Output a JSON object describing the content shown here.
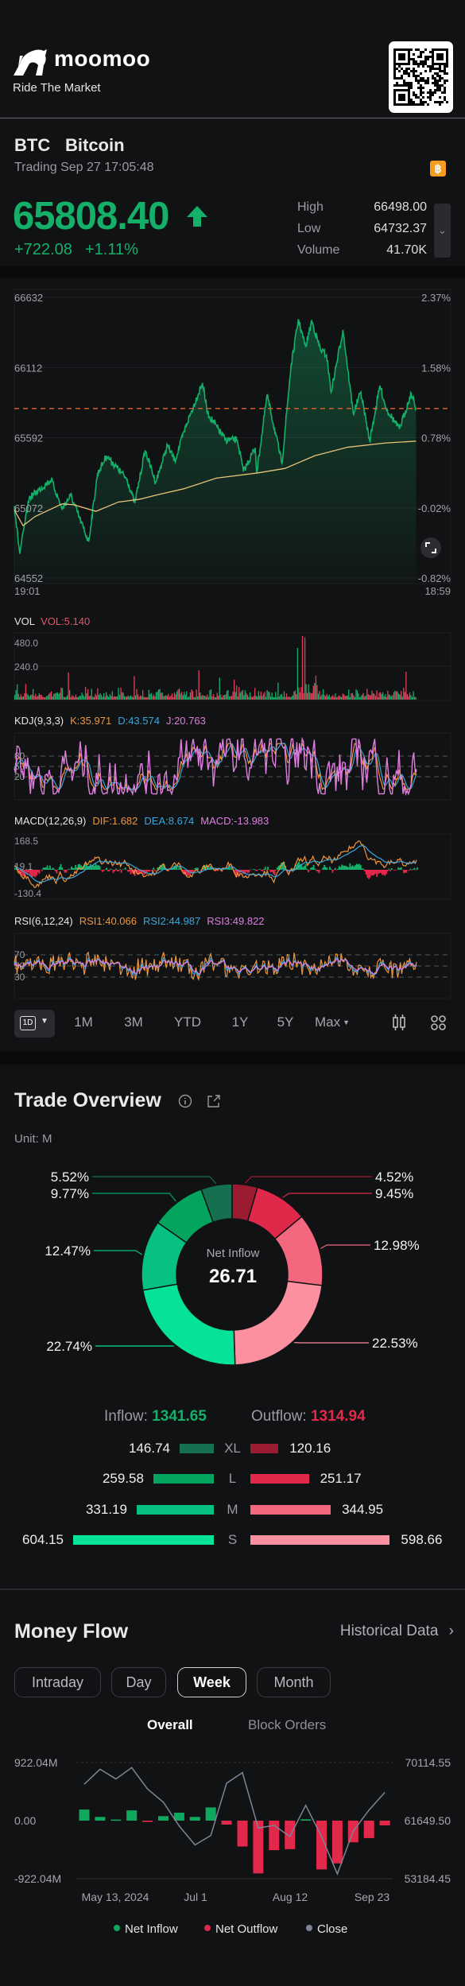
{
  "header": {
    "brand": "moomoo",
    "tagline": "Ride The Market",
    "qr_icon": "qr-code"
  },
  "quote": {
    "symbol": "BTC",
    "name": "Bitcoin",
    "status": "Trading Sep 27 17:05:48",
    "badge_icon": "bitcoin-icon",
    "badge_color": "#f39c1f",
    "price": "65808.40",
    "direction_icon": "arrow-up-icon",
    "change": "+722.08",
    "change_pct": "+1.11%",
    "up_color": "#14b06a",
    "stats": [
      {
        "label": "High",
        "value": "66498.00"
      },
      {
        "label": "Low",
        "value": "64732.37"
      },
      {
        "label": "Volume",
        "value": "41.70K"
      }
    ]
  },
  "chart_data": [
    {
      "type": "line",
      "name": "intraday",
      "y_ticks": [
        "66632",
        "66112",
        "65592",
        "65072",
        "64552"
      ],
      "y_pct_ticks": [
        "2.37%",
        "1.58%",
        "0.78%",
        "-0.02%",
        "-0.82%"
      ],
      "ylim": [
        64552,
        66632
      ],
      "x_labels": [
        "19:01",
        "18:59"
      ],
      "price": [
        [
          "19:01",
          65086
        ],
        [
          "19:19",
          64732
        ],
        [
          "19:50",
          65144
        ],
        [
          "21:03",
          65282
        ],
        [
          "21:38",
          65066
        ],
        [
          "22:07",
          65164
        ],
        [
          "23:06",
          64821
        ],
        [
          "23:35",
          65321
        ],
        [
          "00:05",
          65459
        ],
        [
          "01:13",
          65282
        ],
        [
          "01:38",
          65105
        ],
        [
          "02:12",
          65498
        ],
        [
          "02:47",
          65262
        ],
        [
          "03:26",
          65537
        ],
        [
          "03:50",
          65420
        ],
        [
          "04:29",
          65694
        ],
        [
          "05:21",
          65998
        ],
        [
          "05:38",
          65772
        ],
        [
          "06:37",
          65576
        ],
        [
          "07:16",
          65576
        ],
        [
          "07:36",
          65341
        ],
        [
          "08:15",
          65517
        ],
        [
          "08:20",
          65331
        ],
        [
          "08:54",
          65910
        ],
        [
          "09:43",
          65400
        ],
        [
          "10:12",
          66106
        ],
        [
          "10:37",
          66469
        ],
        [
          "11:01",
          66263
        ],
        [
          "11:21",
          66459
        ],
        [
          "11:50",
          66243
        ],
        [
          "12:10",
          66204
        ],
        [
          "12:25",
          65929
        ],
        [
          "13:04",
          66391
        ],
        [
          "13:38",
          65772
        ],
        [
          "14:03",
          65929
        ],
        [
          "14:32",
          65566
        ],
        [
          "15:06",
          65978
        ],
        [
          "15:26",
          65812
        ],
        [
          "16:10",
          65655
        ],
        [
          "16:49",
          65920
        ],
        [
          "17:05",
          65808.4
        ]
      ],
      "average": [
        [
          "19:01",
          65056
        ],
        [
          "19:30",
          64939
        ],
        [
          "20:09",
          65007
        ],
        [
          "21:38",
          65101
        ],
        [
          "22:17",
          65095
        ],
        [
          "23:30",
          65046
        ],
        [
          "00:44",
          65115
        ],
        [
          "01:53",
          65135
        ],
        [
          "02:51",
          65168
        ],
        [
          "04:19",
          65213
        ],
        [
          "06:07",
          65292
        ],
        [
          "08:24",
          65331
        ],
        [
          "09:53",
          65364
        ],
        [
          "11:31",
          65458
        ],
        [
          "13:19",
          65521
        ],
        [
          "15:26",
          65553
        ],
        [
          "17:05",
          65566
        ]
      ],
      "current_price_line": 65808.4,
      "colors": {
        "price": "#14b06a",
        "average": "#e8c27a",
        "current": "#e0652b"
      }
    },
    {
      "type": "bar",
      "name": "volume",
      "title": "VOL",
      "readout": "VOL:5.140",
      "y_ticks": [
        "480.0",
        "240.0"
      ]
    },
    {
      "type": "line",
      "name": "kdj",
      "title": "KDJ(9,3,3)",
      "readouts": [
        {
          "text": "K:35.971",
          "color": "#f0953a"
        },
        {
          "text": "D:43.574",
          "color": "#3aa7dc"
        },
        {
          "text": "J:20.763",
          "color": "#e07ee0"
        }
      ],
      "y_ticks": [
        "80",
        "50",
        "20"
      ]
    },
    {
      "type": "line",
      "name": "macd",
      "title": "MACD(12,26,9)",
      "readouts": [
        {
          "text": "DIF:1.682",
          "color": "#f0953a"
        },
        {
          "text": "DEA:8.674",
          "color": "#3aa7dc"
        },
        {
          "text": "MACD:-13.983",
          "color": "#e07ee0"
        }
      ],
      "y_ticks": [
        "168.5",
        "19.1",
        "-130.4"
      ]
    },
    {
      "type": "line",
      "name": "rsi",
      "title": "RSI(6,12,24)",
      "readouts": [
        {
          "text": "RSI1:40.066",
          "color": "#f0953a"
        },
        {
          "text": "RSI2:44.987",
          "color": "#3aa7dc"
        },
        {
          "text": "RSI3:49.822",
          "color": "#e07ee0"
        }
      ],
      "y_ticks": [
        "70",
        "50",
        "30"
      ]
    },
    {
      "type": "pie",
      "name": "trade-overview-donut",
      "center_label": "Net Inflow",
      "center_value": "26.71",
      "slices": [
        {
          "side": "outflow",
          "size": "XL",
          "pct": 4.52,
          "label": "4.52%",
          "color": "#9b1c30"
        },
        {
          "side": "outflow",
          "size": "L",
          "pct": 9.45,
          "label": "9.45%",
          "color": "#e0284a"
        },
        {
          "side": "outflow",
          "size": "M",
          "pct": 12.98,
          "label": "12.98%",
          "color": "#f4687f"
        },
        {
          "side": "outflow",
          "size": "S",
          "pct": 22.53,
          "label": "22.53%",
          "color": "#fc8fa0"
        },
        {
          "side": "inflow",
          "size": "S",
          "pct": 22.74,
          "label": "22.74%",
          "color": "#05e39a"
        },
        {
          "side": "inflow",
          "size": "M",
          "pct": 12.47,
          "label": "12.47%",
          "color": "#07c182"
        },
        {
          "side": "inflow",
          "size": "L",
          "pct": 9.77,
          "label": "9.77%",
          "color": "#03a45e"
        },
        {
          "side": "inflow",
          "size": "XL",
          "pct": 5.52,
          "label": "5.52%",
          "color": "#15704f"
        }
      ]
    },
    {
      "type": "bar",
      "name": "money-flow-week",
      "y_ticks_left": [
        "922.04M",
        "0.00",
        "-922.04M"
      ],
      "ylim_left": [
        -922.04,
        922.04
      ],
      "y_ticks_right": [
        "70114.55",
        "61649.50",
        "53184.45"
      ],
      "ylim_right": [
        53184.45,
        70114.55
      ],
      "x_labels": [
        {
          "text": "May 13, 2024",
          "index": 0
        },
        {
          "text": "Jul 1",
          "index": 7
        },
        {
          "text": "Aug 12",
          "index": 13
        },
        {
          "text": "Sep 23",
          "index": 19
        }
      ],
      "net_flow_m": [
        176,
        59,
        17,
        163,
        -21,
        71,
        126,
        59,
        210,
        -63,
        -411,
        -838,
        -469,
        -453,
        21,
        -775,
        -679,
        -344,
        -277,
        -75
      ],
      "close": [
        66959,
        69152,
        67729,
        69383,
        66267,
        64342,
        60879,
        58108,
        59494,
        67113,
        68652,
        60571,
        60956,
        59340,
        63881,
        59340,
        53876,
        60110,
        63188,
        65766
      ],
      "legend": [
        {
          "label": "Net Inflow",
          "color": "#10a75e"
        },
        {
          "label": "Net Outflow",
          "color": "#e2294b"
        },
        {
          "label": "Close",
          "color": "#7d8496"
        }
      ]
    }
  ],
  "periods": {
    "selected": "1D",
    "items": [
      "1M",
      "3M",
      "YTD",
      "1Y",
      "5Y",
      "Max"
    ]
  },
  "trade_overview": {
    "title": "Trade Overview",
    "unit": "Unit: M",
    "inflow_label": "Inflow:",
    "inflow": "1341.65",
    "outflow_label": "Outflow:",
    "outflow": "1314.94",
    "rows": [
      {
        "size": "XL",
        "in": "146.74",
        "out": "120.16",
        "in_v": 146.74,
        "out_v": 120.16,
        "in_color": "#15704f",
        "out_color": "#9b1c30"
      },
      {
        "size": "L",
        "in": "259.58",
        "out": "251.17",
        "in_v": 259.58,
        "out_v": 251.17,
        "in_color": "#03a45e",
        "out_color": "#e0284a"
      },
      {
        "size": "M",
        "in": "331.19",
        "out": "344.95",
        "in_v": 331.19,
        "out_v": 344.95,
        "in_color": "#07c182",
        "out_color": "#f4687f"
      },
      {
        "size": "S",
        "in": "604.15",
        "out": "598.66",
        "in_v": 604.15,
        "out_v": 598.66,
        "in_color": "#05e39a",
        "out_color": "#fc8fa0"
      }
    ]
  },
  "money_flow": {
    "title": "Money Flow",
    "historical": "Historical Data",
    "tabs": [
      "Intraday",
      "Day",
      "Week",
      "Month"
    ],
    "selected_tab": "Week",
    "subtabs": [
      "Overall",
      "Block Orders"
    ],
    "selected_subtab": "Overall"
  }
}
